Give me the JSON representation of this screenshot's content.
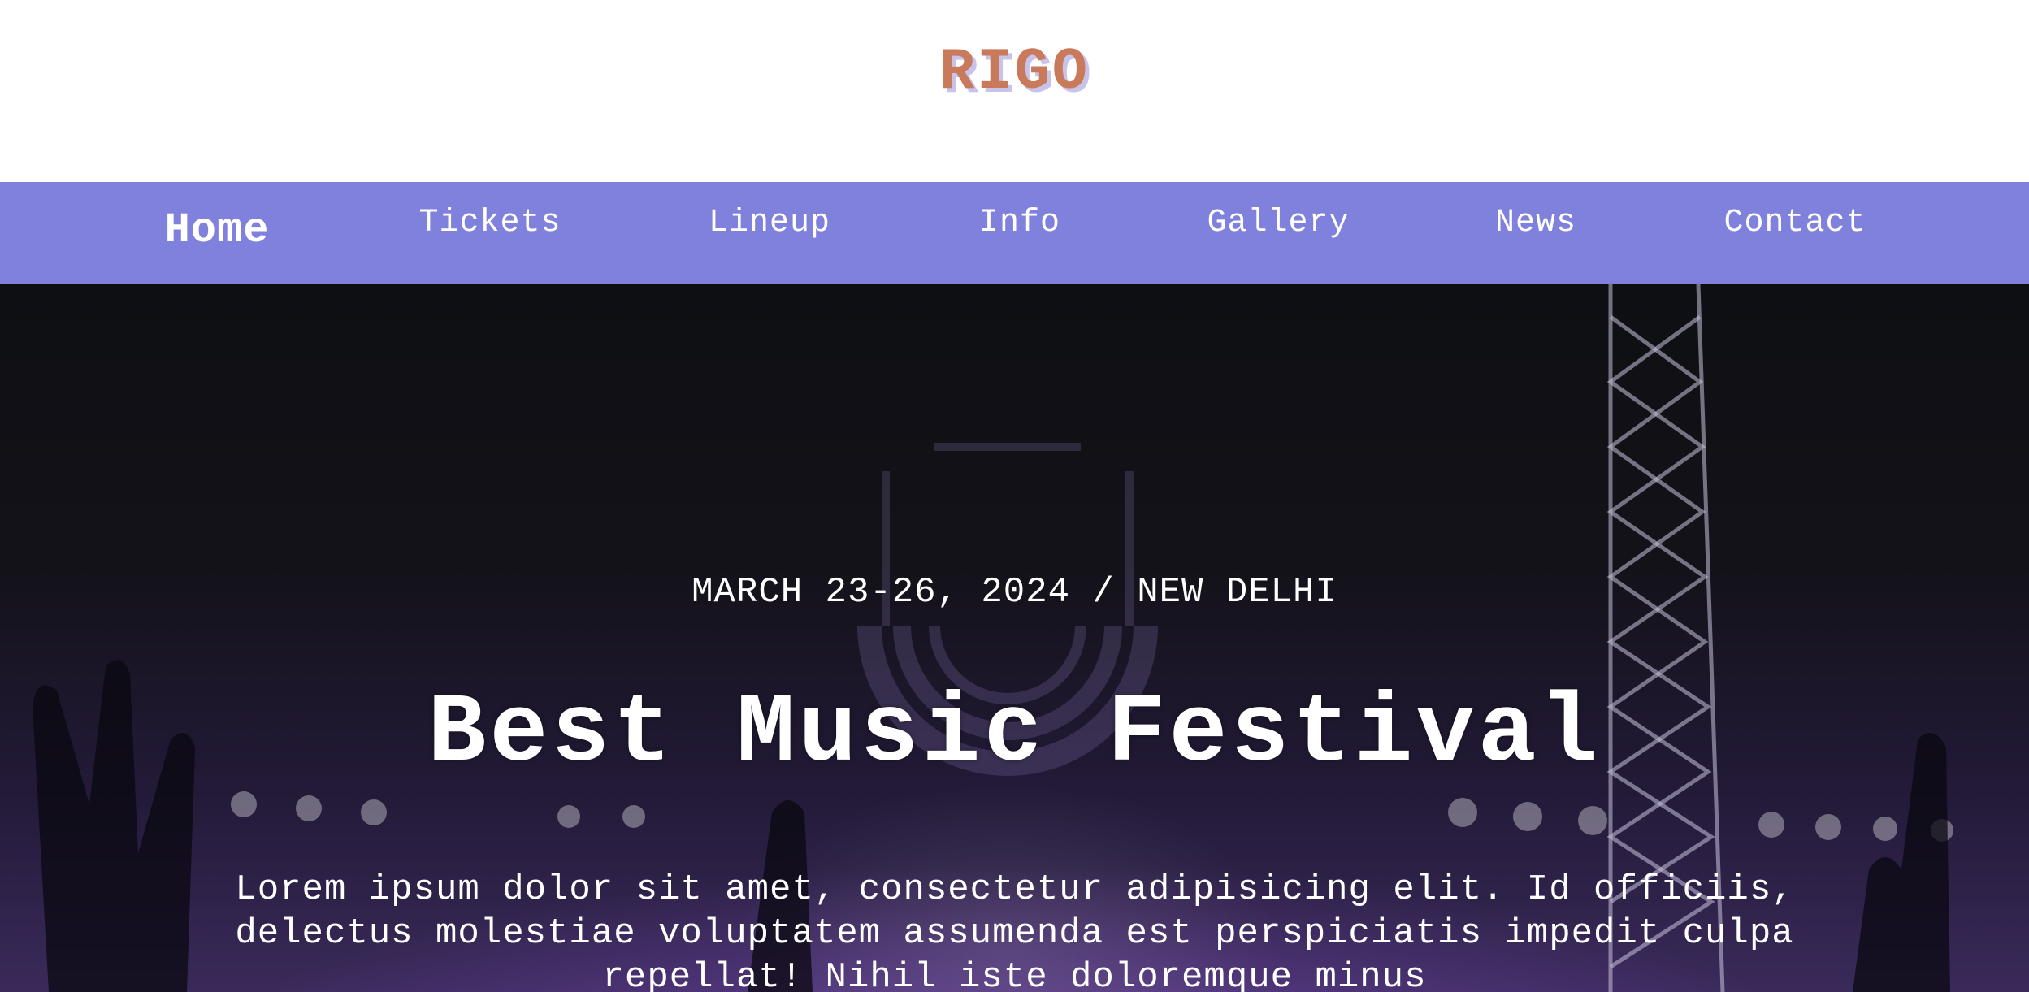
{
  "brand": {
    "logo_text": "RIGO"
  },
  "nav": {
    "items": [
      {
        "label": "Home",
        "active": true
      },
      {
        "label": "Tickets"
      },
      {
        "label": "Lineup"
      },
      {
        "label": "Info"
      },
      {
        "label": "Gallery"
      },
      {
        "label": "News"
      },
      {
        "label": "Contact"
      }
    ]
  },
  "hero": {
    "date_location": "MARCH 23-26, 2024 / NEW DELHI",
    "title": "Best Music Festival",
    "description": "Lorem ipsum dolor sit amet, consectetur adipisicing elit. Id officiis, delectus molestiae voluptatem assumenda est perspiciatis impedit culpa repellat! Nihil iste doloremque minus"
  },
  "colors": {
    "nav_background": "#8080dd",
    "logo": "#c97a5a",
    "logo_shadow": "#c8c3ea",
    "hero_overlay": "#13121a"
  }
}
